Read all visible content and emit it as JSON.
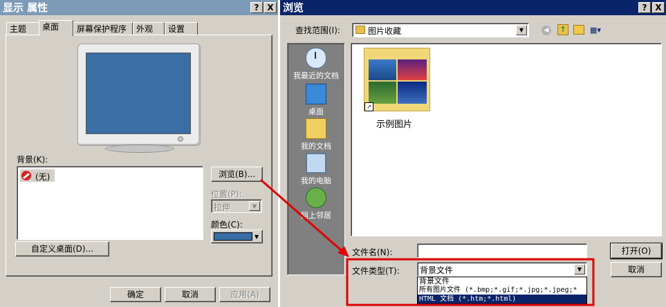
{
  "display_props": {
    "title": "显示 属性",
    "help_btn": "?",
    "close_btn": "X",
    "tabs": [
      "主题",
      "桌面",
      "屏幕保护程序",
      "外观",
      "设置"
    ],
    "background_label": "背景(K):",
    "background_items": [
      {
        "icon": "none-icon",
        "label": "(无)"
      }
    ],
    "browse_button": "浏览(B)...",
    "position_label": "位置(P):",
    "position_value": "拉伸",
    "color_label": "颜色(C):",
    "color_value": "#3a6ea5",
    "customize_button": "自定义桌面(D)...",
    "ok_button": "确定",
    "cancel_button": "取消",
    "apply_button": "应用(A)"
  },
  "browse": {
    "title": "浏览",
    "help_btn": "?",
    "close_btn": "X",
    "lookin_label": "查找范围(I):",
    "lookin_value": "图片收藏",
    "places": [
      "我最近的文档",
      "桌面",
      "我的文档",
      "我的电脑",
      "网上邻居"
    ],
    "files": [
      {
        "name": "示例图片",
        "type": "folder-shortcut"
      }
    ],
    "filename_label": "文件名(N):",
    "filename_value": "",
    "filetype_label": "文件类型(T):",
    "filetype_value": "背景文件",
    "filetype_options": [
      "背景文件",
      "所有图片文件 (*.bmp;*.gif;*.jpg;*.jpeg;*",
      "HTML 文档 (*.htm;*.html)"
    ],
    "open_button": "打开(O)",
    "cancel_button": "取消"
  },
  "colors": {
    "active_title": "#0a246a",
    "inactive_title": "#7d9ab7",
    "annotation": "#e00000",
    "desktop_blue": "#3a6ea5"
  }
}
